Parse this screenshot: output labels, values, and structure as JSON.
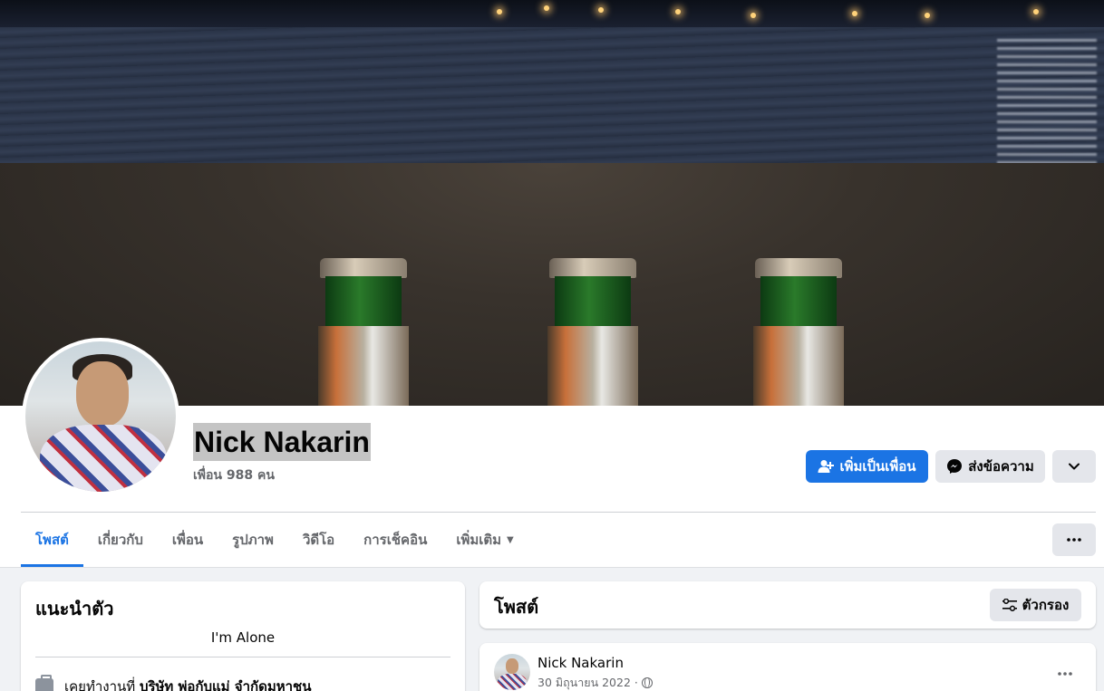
{
  "profile": {
    "name": "Nick Nakarin",
    "friends_count": "เพื่อน 988 คน"
  },
  "actions": {
    "add_friend": "เพิ่มเป็นเพื่อน",
    "message": "ส่งข้อความ"
  },
  "tabs": [
    {
      "label": "โพสต์",
      "active": true
    },
    {
      "label": "เกี่ยวกับ"
    },
    {
      "label": "เพื่อน"
    },
    {
      "label": "รูปภาพ"
    },
    {
      "label": "วิดีโอ"
    },
    {
      "label": "การเช็คอิน"
    },
    {
      "label": "เพิ่มเติม"
    }
  ],
  "intro": {
    "title": "แนะนำตัว",
    "bio": "I'm Alone",
    "work_prefix": "เคยทำงานที่",
    "work_company": "บริษัท พ่อกับแม่ จำกัดมหาชน"
  },
  "posts": {
    "title": "โพสต์",
    "filter_label": "ตัวกรอง"
  },
  "post": {
    "author": "Nick Nakarin",
    "date": "30 มิถุนายน 2022 ·"
  },
  "colors": {
    "primary": "#1b74e4",
    "secondary_bg": "#e4e6eb",
    "page_bg": "#f0f2f5",
    "muted_text": "#65676b"
  },
  "icons": {
    "add_friend": "person-plus-icon",
    "message": "messenger-icon",
    "chevron": "chevron-down-icon",
    "more": "more-dots-icon",
    "filter": "sliders-icon",
    "work": "briefcase-icon",
    "privacy": "globe-icon"
  }
}
